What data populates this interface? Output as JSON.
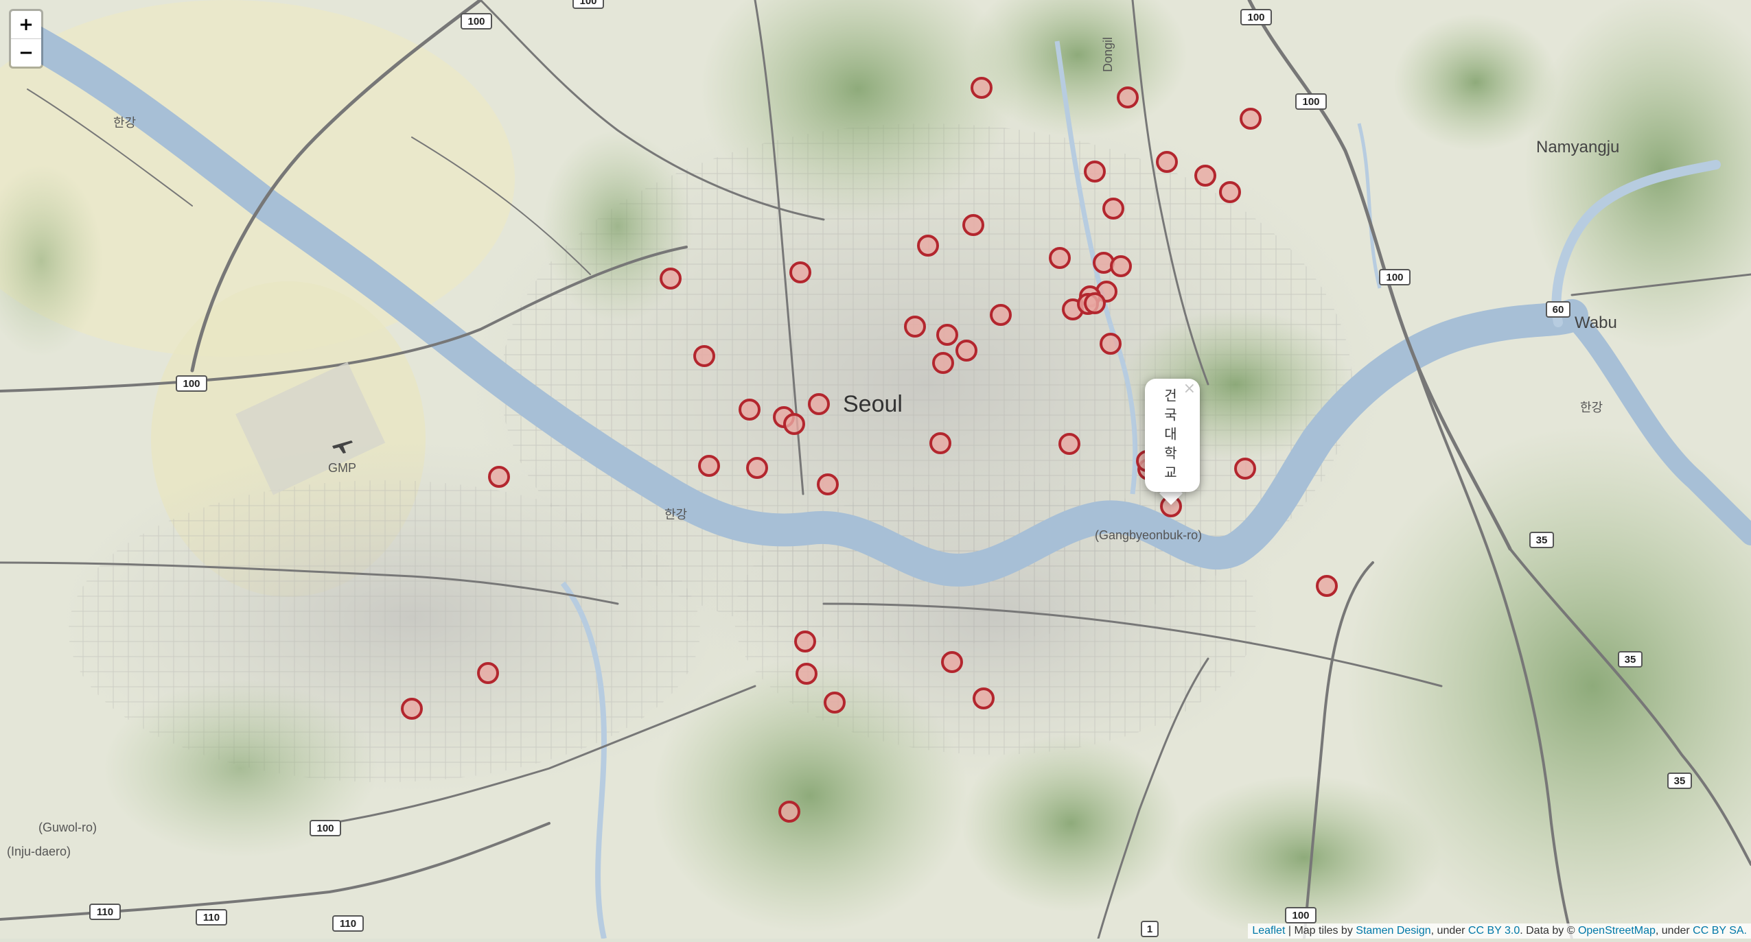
{
  "zoom": {
    "in_label": "+",
    "out_label": "−"
  },
  "labels": {
    "city": "Seoul",
    "namyangju": "Namyangju",
    "wabu": "Wabu",
    "gmp": "GMP",
    "river_han_1": "한강",
    "river_han_2": "한강",
    "river_han_3": "한강",
    "gangbyeonbuk": "(Gangbyeonbuk-ro)",
    "guwol": "(Guwol-ro)",
    "injudaero": "(Inju-daero)",
    "dongil": "Dongil"
  },
  "road_shields": [
    {
      "name": "shield-100-a",
      "text": "100"
    },
    {
      "name": "shield-100-b",
      "text": "100"
    },
    {
      "name": "shield-100-c",
      "text": "100"
    },
    {
      "name": "shield-100-d",
      "text": "100"
    },
    {
      "name": "shield-100-e",
      "text": "100"
    },
    {
      "name": "shield-100-f",
      "text": "100"
    },
    {
      "name": "shield-100-g",
      "text": "100"
    },
    {
      "name": "shield-100-h",
      "text": "100"
    },
    {
      "name": "shield-60",
      "text": "60"
    },
    {
      "name": "shield-35-a",
      "text": "35"
    },
    {
      "name": "shield-35-b",
      "text": "35"
    },
    {
      "name": "shield-35-c",
      "text": "35"
    },
    {
      "name": "shield-110-a",
      "text": "110"
    },
    {
      "name": "shield-110-b",
      "text": "110"
    },
    {
      "name": "shield-110-c",
      "text": "110"
    },
    {
      "name": "shield-1",
      "text": "1"
    }
  ],
  "marker_style": {
    "fill": "#e8a9a3",
    "stroke": "#b3262e"
  },
  "markers_count_visible": 50,
  "popup": {
    "text": "건국대학교",
    "close": "×"
  },
  "attribution": {
    "leaflet": "Leaflet",
    "sep1": " | Map tiles by ",
    "stamen": "Stamen Design",
    "sep2": ", under ",
    "ccby": "CC BY 3.0",
    "sep3": ". Data by © ",
    "osm": "OpenStreetMap",
    "sep4": ", under ",
    "ccbysa": "CC BY SA."
  }
}
